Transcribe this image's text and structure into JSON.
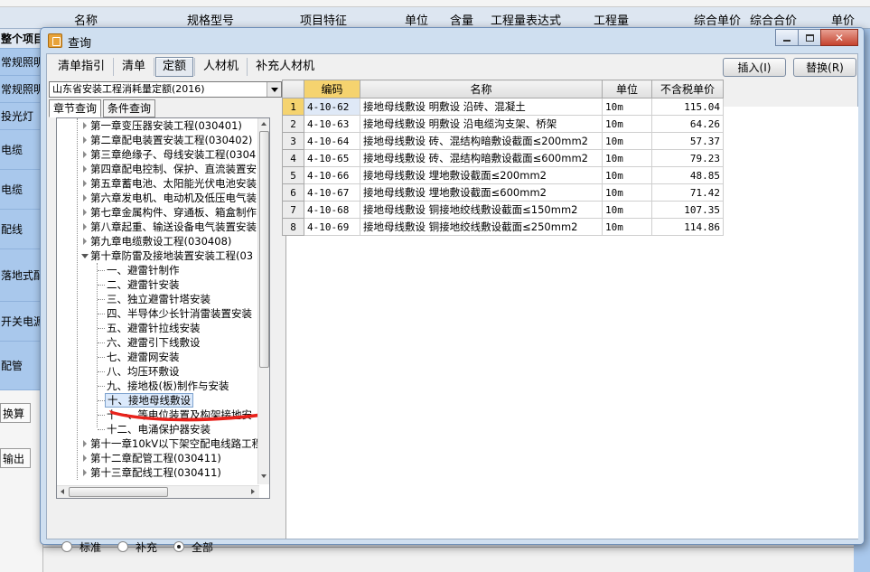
{
  "background": {
    "header_columns": [
      "名称",
      "规格型号",
      "项目特征",
      "单位",
      "含量",
      "工程量表达式",
      "工程量",
      "综合单价",
      "综合合价",
      "单价"
    ],
    "left_rows": [
      "整个项目",
      "常规照明",
      "常规照明",
      "投光灯",
      "电缆",
      "电缆",
      "配线",
      "落地式配",
      "开关电源",
      "配管"
    ],
    "tabs": [
      "换算",
      "输出"
    ]
  },
  "dialog": {
    "title": "查询",
    "tabs": [
      "清单指引",
      "清单",
      "定额",
      "人材机",
      "补充人材机"
    ],
    "active_tab": "定额",
    "insert_button": "插入(I)",
    "replace_button": "替换(R)",
    "quota_select": "山东省安装工程消耗量定额(2016)",
    "subtabs": [
      "章节查询",
      "条件查询"
    ],
    "tree": {
      "chapters_before": [
        "第一章变压器安装工程(030401)",
        "第二章配电装置安装工程(030402)",
        "第三章绝缘子、母线安装工程(0304",
        "第四章配电控制、保护、直流装置安",
        "第五章蓄电池、太阳能光伏电池安装",
        "第六章发电机、电动机及低压电气装",
        "第七章金属构件、穿通板、箱盒制作",
        "第八章起重、输送设备电气装置安装",
        "第九章电缆敷设工程(030408)"
      ],
      "expanded": "第十章防雷及接地装置安装工程(03",
      "children": [
        "一、避雷针制作",
        "二、避雷针安装",
        "三、独立避雷针塔安装",
        "四、半导体少长针消雷装置安装",
        "五、避雷针拉线安装",
        "六、避雷引下线敷设",
        "七、避雷网安装",
        "八、均压环敷设",
        "九、接地极(板)制作与安装",
        "十、接地母线敷设",
        "十一、等电位装置及构架接地安",
        "十二、电涌保护器安装"
      ],
      "selected": "十、接地母线敷设",
      "chapters_after": [
        "第十一章10kV以下架空配电线路工程",
        "第十二章配管工程(030411)",
        "第十三章配线工程(030411)"
      ]
    },
    "radios": [
      "标准",
      "补充",
      "全部"
    ],
    "radio_selected": "全部",
    "grid": {
      "headers": [
        "编码",
        "名称",
        "单位",
        "不含税单价"
      ],
      "rows": [
        {
          "n": "1",
          "code": "4-10-62",
          "name": "接地母线敷设 明敷设 沿砖、混凝土",
          "unit": "10m",
          "price": "115.04"
        },
        {
          "n": "2",
          "code": "4-10-63",
          "name": "接地母线敷设 明敷设 沿电缆沟支架、桥架",
          "unit": "10m",
          "price": "64.26"
        },
        {
          "n": "3",
          "code": "4-10-64",
          "name": "接地母线敷设 砖、混结构暗敷设截面≤200mm2",
          "unit": "10m",
          "price": "57.37"
        },
        {
          "n": "4",
          "code": "4-10-65",
          "name": "接地母线敷设 砖、混结构暗敷设截面≤600mm2",
          "unit": "10m",
          "price": "79.23"
        },
        {
          "n": "5",
          "code": "4-10-66",
          "name": "接地母线敷设 埋地敷设截面≤200mm2",
          "unit": "10m",
          "price": "48.85"
        },
        {
          "n": "6",
          "code": "4-10-67",
          "name": "接地母线敷设 埋地敷设截面≤600mm2",
          "unit": "10m",
          "price": "71.42"
        },
        {
          "n": "7",
          "code": "4-10-68",
          "name": "接地母线敷设 铜接地绞线敷设截面≤150mm2",
          "unit": "10m",
          "price": "107.35"
        },
        {
          "n": "8",
          "code": "4-10-69",
          "name": "接地母线敷设 铜接地绞线敷设截面≤250mm2",
          "unit": "10m",
          "price": "114.86"
        }
      ]
    }
  }
}
